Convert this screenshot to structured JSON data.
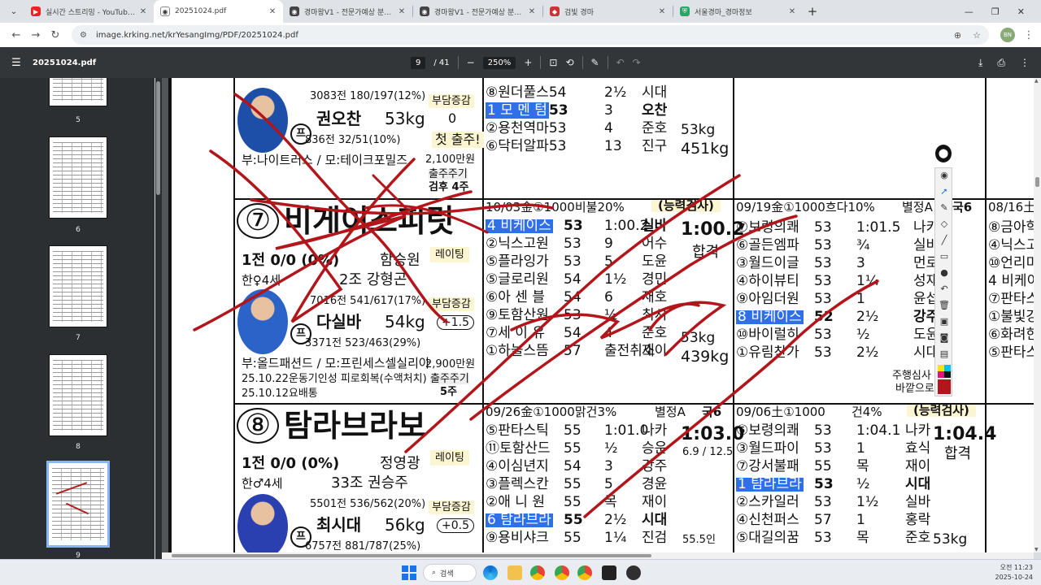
{
  "tabs": [
    {
      "title": "실시간 스트리밍 - YouTube Stu",
      "favcolor": "#e22",
      "active": false
    },
    {
      "title": "20251024.pdf",
      "favcolor": "#555",
      "active": true
    },
    {
      "title": "경마왕V1 - 전문가예상 분석은",
      "favcolor": "#444",
      "active": false
    },
    {
      "title": "경마왕V1 - 전문가예상 분석은",
      "favcolor": "#444",
      "active": false
    },
    {
      "title": "검빛 경마",
      "favcolor": "#c33",
      "active": false
    },
    {
      "title": "서울경마_경마정보",
      "favcolor": "#2a6",
      "active": false
    }
  ],
  "address": {
    "url": "image.krking.net/krYesangImg/PDF/20251024.pdf",
    "profile": "BN"
  },
  "pdf": {
    "title": "20251024.pdf",
    "page": "9",
    "total": "/ 41",
    "zoom": "250%"
  },
  "thumbnails": {
    "labels": [
      "5",
      "6",
      "7",
      "8",
      "9"
    ]
  },
  "sheet": {
    "h7": {
      "number": "⑦",
      "name": "비게이스피릿",
      "rating": "레이팅",
      "record": "1전 0/0 (0%)",
      "trainer": "함승원",
      "age": "한♀4세",
      "group": "2조 강형곤",
      "stats1": "7016전 541/617(17%)",
      "jockey": "다실바",
      "weight": "54kg",
      "stats2": "3371전 523/463(29%)",
      "load_label": "부담증감",
      "load": "+1.5",
      "owner": "부:올드패션드 / 모:프린세스셀실리아",
      "note1": "25.10.22운동기인성 피로회복(수액처치)",
      "note2": "25.10.12요배통",
      "prize": "2,900만원",
      "cycle": "출주주기",
      "cycle_val": "5주"
    },
    "h8": {
      "number": "⑧",
      "name": "탐라브라보",
      "rating": "레이팅",
      "record": "1전 0/0 (0%)",
      "trainer": "정영광",
      "age": "한♂4세",
      "group": "33조 권승주",
      "stats1": "5501전 536/562(20%)",
      "jockey": "최시대",
      "weight": "56kg",
      "stats2": "6757전 881/787(25%)",
      "load_label": "부담증감",
      "load": "+0.5"
    },
    "h6": {
      "jockey": "권오찬",
      "weight": "53kg",
      "stats1": "3083전 180/197(12%)",
      "stats2": "836전 32/51(10%)",
      "owner": "부:나이트러스 / 모:테이크포밀즈",
      "load_label": "부담증감",
      "load": "0",
      "first_run": "첫 출주!",
      "prize": "2,100만원",
      "cycle": "출주주기",
      "cycle_val": "검후 4주"
    },
    "race_a": {
      "header": "10/03金①1000비불20%",
      "tag": "(능력검사)",
      "rows": [
        {
          "name": "4 비케이스",
          "wt": "53",
          "val": "1:00.2",
          "jk": "실바",
          "hl": true
        },
        {
          "name": "②닉스고원",
          "wt": "53",
          "val": "9",
          "jk": "어수"
        },
        {
          "name": "⑤플라잉가",
          "wt": "53",
          "val": "5",
          "jk": "도윤"
        },
        {
          "name": "⑤글로리원",
          "wt": "54",
          "val": "1½",
          "jk": "경민"
        },
        {
          "name": "⑥아 센 블",
          "wt": "54",
          "val": "6",
          "jk": "재호"
        },
        {
          "name": "⑨토함산원",
          "wt": "53",
          "val": "½",
          "jk": "최시"
        },
        {
          "name": "⑦세 이 유",
          "wt": "54",
          "val": "4",
          "jk": "준호"
        },
        {
          "name": "①하늘스뜸",
          "wt": "57",
          "val": "출전취소",
          "jk": "재이"
        }
      ],
      "time": "1:00.2",
      "result": "합격",
      "weight_after": "53kg",
      "weight_total": "439kg",
      "top_rows": [
        {
          "name": "⑧원더풀스",
          "wt": "54",
          "val": "2½",
          "jk": "시대"
        },
        {
          "name": "1 모 멘 텀",
          "wt": "53",
          "val": "3",
          "jk": "오찬",
          "hl": true
        },
        {
          "name": "②용천역마",
          "wt": "53",
          "val": "4",
          "jk": "준호"
        },
        {
          "name": "⑥닥터알파",
          "wt": "53",
          "val": "13",
          "jk": "진구"
        }
      ],
      "top_weight": "53kg",
      "top_total": "451kg"
    },
    "race_b": {
      "header": "09/19金①1000흐다10%",
      "tag": "별정A",
      "grade": "국6",
      "rows": [
        {
          "name": "⑦보령의쾌",
          "wt": "53",
          "val": "1:01.5",
          "jk": "나카"
        },
        {
          "name": "⑥골든엠파",
          "wt": "53",
          "val": "¾",
          "jk": "실바"
        },
        {
          "name": "③월드이글",
          "wt": "53",
          "val": "3",
          "jk": "먼로"
        },
        {
          "name": "④하이뷰티",
          "wt": "53",
          "val": "1¼",
          "jk": "성재"
        },
        {
          "name": "⑨아임더원",
          "wt": "53",
          "val": "1",
          "jk": "윤섭"
        },
        {
          "name": "8 비케이스",
          "wt": "52",
          "val": "2½",
          "jk": "강주",
          "hl": true
        },
        {
          "name": "⑩바이럴히",
          "wt": "53",
          "val": "½",
          "jk": "도윤"
        },
        {
          "name": "①유림찬가",
          "wt": "53",
          "val": "2½",
          "jk": "시대"
        }
      ],
      "note": "주행심사",
      "note2": "바깥으로"
    },
    "race_c": {
      "header": "09/26金①1000맑건3%",
      "tag": "별정A",
      "grade": "국6",
      "rows": [
        {
          "name": "⑤판타스틱",
          "wt": "55",
          "val": "1:01.0",
          "jk": "나카"
        },
        {
          "name": "⑪토함산드",
          "wt": "55",
          "val": "½",
          "jk": "승운"
        },
        {
          "name": "④이심년지",
          "wt": "54",
          "val": "3",
          "jk": "강주"
        },
        {
          "name": "③플렉스칸",
          "wt": "55",
          "val": "5",
          "jk": "경윤"
        },
        {
          "name": "②애 니 원",
          "wt": "55",
          "val": "목",
          "jk": "재이"
        },
        {
          "name": "6 탐라브라",
          "wt": "55",
          "val": "2½",
          "jk": "시대",
          "hl": true
        },
        {
          "name": "⑨용비샤크",
          "wt": "55",
          "val": "1¼",
          "jk": "진검"
        }
      ],
      "time": "1:03.0",
      "sub": "6.9 / 12.5",
      "weight_after": "55.5인"
    },
    "race_d": {
      "header": "09/06土①1000",
      "tag": "건4%",
      "tag2": "(능력검사)",
      "rows": [
        {
          "name": "⑥보령의쾌",
          "wt": "53",
          "val": "1:04.1",
          "jk": "나카"
        },
        {
          "name": "③월드파이",
          "wt": "53",
          "val": "1",
          "jk": "효식"
        },
        {
          "name": "⑦강서불패",
          "wt": "55",
          "val": "목",
          "jk": "재이"
        },
        {
          "name": "1 탐라브라",
          "wt": "53",
          "val": "½",
          "jk": "시대",
          "hl": true
        },
        {
          "name": "②스카일러",
          "wt": "53",
          "val": "1½",
          "jk": "실바"
        },
        {
          "name": "④신천퍼스",
          "wt": "57",
          "val": "1",
          "jk": "홍락"
        },
        {
          "name": "⑤대길의꿈",
          "wt": "53",
          "val": "목",
          "jk": "준호"
        }
      ],
      "time": "1:04.4",
      "result": "합격",
      "weight_after": "53kg"
    },
    "race_e": {
      "header": "08/16土",
      "rows": [
        "⑧금아학",
        "④닉스고",
        "⑩언리미",
        "4 비케이",
        "⑦판타스",
        "①불빛강",
        "⑥화려한",
        "⑤판타스"
      ]
    }
  },
  "taskbar": {
    "search": "검색",
    "time": "오전 11:23",
    "date": "2025-10-24"
  }
}
